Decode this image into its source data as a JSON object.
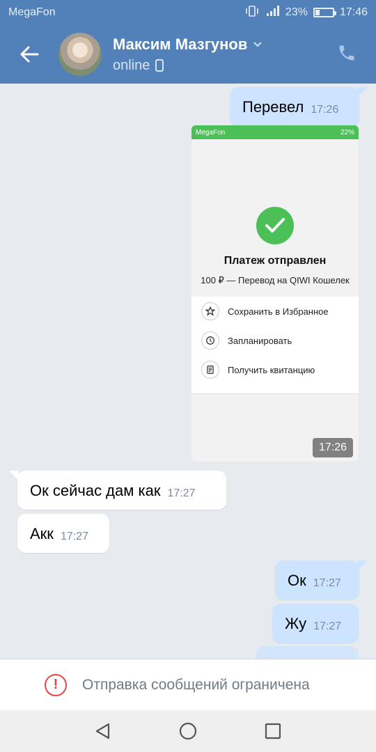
{
  "status": {
    "carrier": "MegaFon",
    "battery": "23%",
    "battery_level": 0.23,
    "time": "17:46"
  },
  "header": {
    "contact_name": "Максим Мазгунов",
    "presence": "online"
  },
  "messages": [
    {
      "dir": "out",
      "text": "Перевел",
      "time": "17:26"
    },
    {
      "dir": "out",
      "type": "image",
      "time": "17:26"
    },
    {
      "dir": "in",
      "text": "Ок сейчас дам как",
      "time": "17:27"
    },
    {
      "dir": "in",
      "text": "Акк",
      "time": "17:27"
    },
    {
      "dir": "out",
      "text": "Ок",
      "time": "17:27"
    },
    {
      "dir": "out",
      "text": "Жу",
      "time": "17:27"
    }
  ],
  "screenshot": {
    "status_carrier": "MegaFon",
    "status_battery": "22%",
    "title": "Платеж отправлен",
    "subtitle": "100 ₽ — Перевод на QIWI Кошелек",
    "menu": [
      {
        "icon": "star-icon",
        "label": "Сохранить в Избранное"
      },
      {
        "icon": "clock-icon",
        "label": "Запланировать"
      },
      {
        "icon": "receipt-icon",
        "label": "Получить квитанцию"
      }
    ]
  },
  "footer": {
    "restriction_text": "Отправка сообщений ограничена"
  },
  "colors": {
    "header": "#5181b8",
    "outgoing": "#cce4ff",
    "incoming": "#ffffff",
    "warning": "#e64646",
    "success": "#4ac057"
  }
}
